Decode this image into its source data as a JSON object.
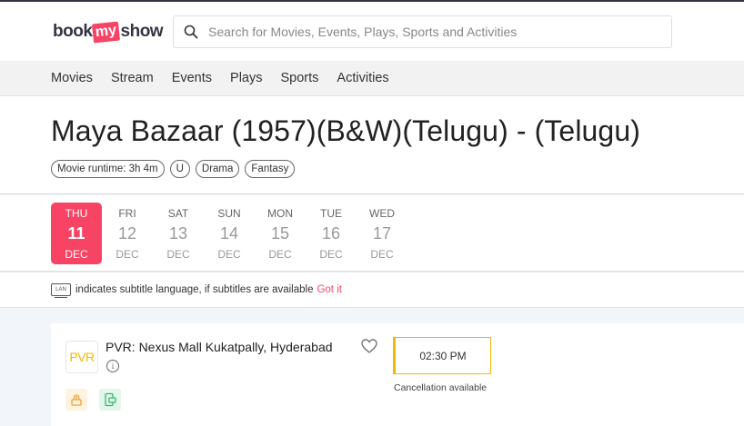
{
  "logo": {
    "part1": "book",
    "part2": "my",
    "part3": "show"
  },
  "search": {
    "placeholder": "Search for Movies, Events, Plays, Sports and Activities"
  },
  "nav": [
    "Movies",
    "Stream",
    "Events",
    "Plays",
    "Sports",
    "Activities"
  ],
  "movie": {
    "title": "Maya Bazaar (1957)(B&W)(Telugu) - (Telugu)",
    "tags": [
      "Movie runtime: 3h 4m",
      "U",
      "Drama",
      "Fantasy"
    ]
  },
  "dates": [
    {
      "day": "THU",
      "num": "11",
      "month": "DEC",
      "active": true
    },
    {
      "day": "FRI",
      "num": "12",
      "month": "DEC",
      "active": false
    },
    {
      "day": "SAT",
      "num": "13",
      "month": "DEC",
      "active": false
    },
    {
      "day": "SUN",
      "num": "14",
      "month": "DEC",
      "active": false
    },
    {
      "day": "MON",
      "num": "15",
      "month": "DEC",
      "active": false
    },
    {
      "day": "TUE",
      "num": "16",
      "month": "DEC",
      "active": false
    },
    {
      "day": "WED",
      "num": "17",
      "month": "DEC",
      "active": false
    }
  ],
  "subtitle_info": {
    "icon_text": "LAN",
    "text": "indicates subtitle language, if subtitles are available",
    "link": "Got it"
  },
  "cinema": {
    "logo_text": "PVR",
    "name": "PVR: Nexus Mall Kukatpally, Hyderabad",
    "info_icon": "i",
    "showtime": "02:30 PM",
    "cancellation": "Cancellation available"
  },
  "colors": {
    "accent": "#f84464",
    "showtime_border": "#f5b800"
  }
}
